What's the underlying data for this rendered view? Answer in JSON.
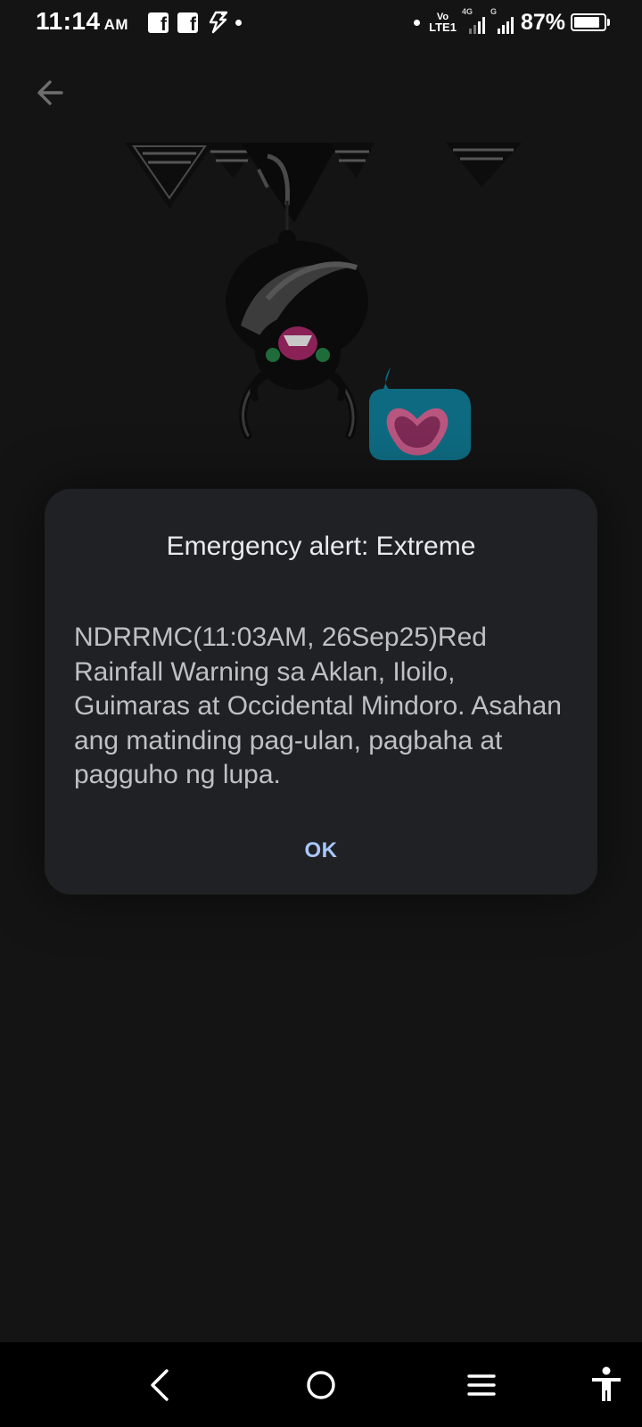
{
  "status_bar": {
    "time": "11:14",
    "ampm": "AM",
    "notification_icons": [
      "facebook-icon",
      "facebook-icon",
      "flash-icon",
      "dot-icon"
    ],
    "volte_top": "Vo",
    "volte_bottom": "LTE1",
    "sim1_network": "4G",
    "sim2_network": "G",
    "battery_percent": "87%",
    "battery_level": 0.87
  },
  "header": {
    "back_icon": "arrow-back-icon"
  },
  "illustration": {
    "description_icon": "spider-illustration"
  },
  "dialog": {
    "title": "Emergency alert: Extreme",
    "message": "NDRRMC(11:03AM, 26Sep25)Red Rainfall Warning sa Aklan, Iloilo, Guimaras at Occidental Mindoro. Asahan ang matinding pag-ulan, pagbaha at pagguho ng lupa.",
    "ok_label": "OK"
  },
  "nav_bar": {
    "icons": [
      "back-icon",
      "home-icon",
      "recents-icon",
      "accessibility-icon"
    ]
  },
  "colors": {
    "background": "#141414",
    "dialog_background": "#202124",
    "accent": "#a8c7fa",
    "title_text": "#e8eaed",
    "body_text": "#bdc1c6"
  }
}
